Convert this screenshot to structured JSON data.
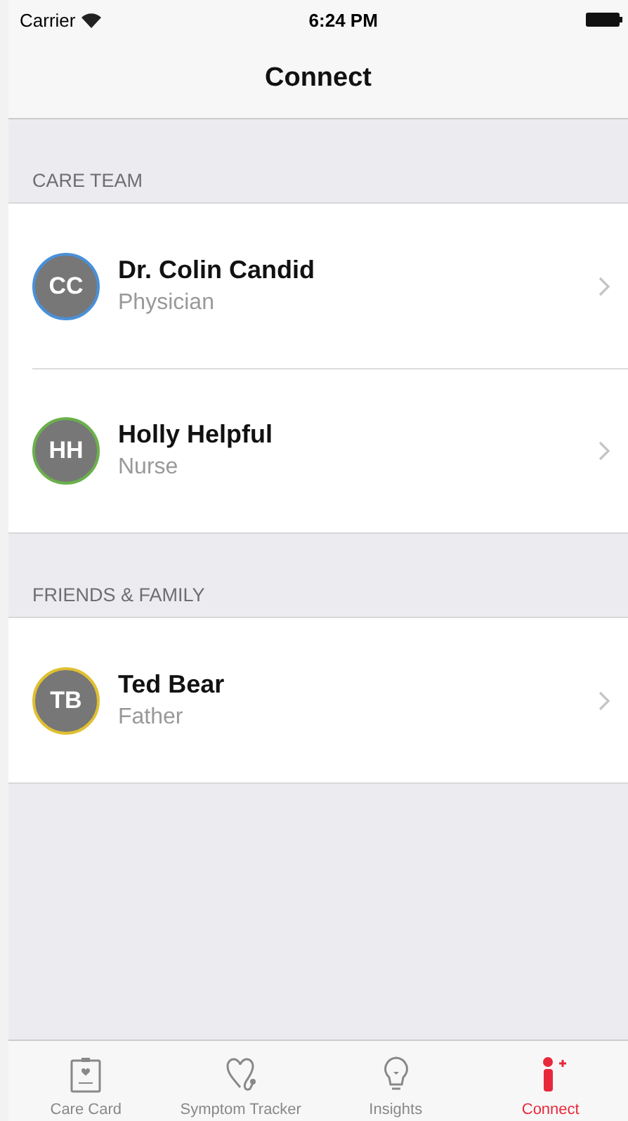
{
  "status_bar": {
    "carrier": "Carrier",
    "time": "6:24 PM"
  },
  "nav": {
    "title": "Connect"
  },
  "sections": [
    {
      "header": "CARE TEAM",
      "contacts": [
        {
          "initials": "CC",
          "name": "Dr. Colin Candid",
          "role": "Physician",
          "color": "#4a90d9"
        },
        {
          "initials": "HH",
          "name": "Holly Helpful",
          "role": "Nurse",
          "color": "#6ab04c"
        }
      ]
    },
    {
      "header": "FRIENDS & FAMILY",
      "contacts": [
        {
          "initials": "TB",
          "name": "Ted Bear",
          "role": "Father",
          "color": "#e0c030"
        }
      ]
    }
  ],
  "tabs": [
    {
      "kind": "card",
      "label": "Care Card",
      "selected": false
    },
    {
      "kind": "stethoscope",
      "label": "Symptom Tracker",
      "selected": false
    },
    {
      "kind": "bulb",
      "label": "Insights",
      "selected": false
    },
    {
      "kind": "connect",
      "label": "Connect",
      "selected": true
    }
  ]
}
